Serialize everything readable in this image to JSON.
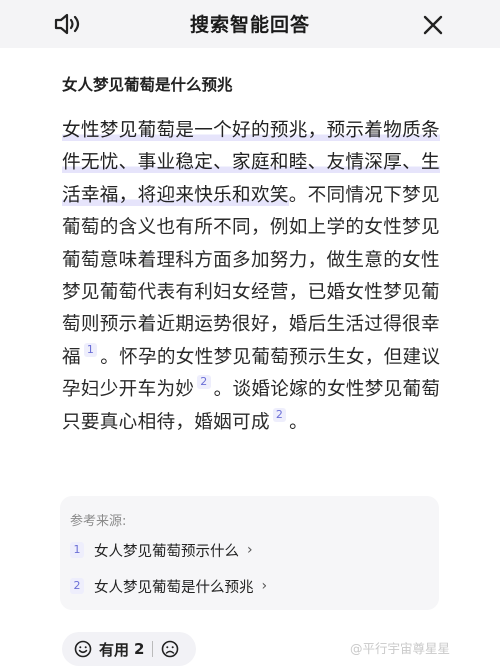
{
  "header": {
    "title": "搜索智能回答",
    "speaker_icon": "speaker-icon",
    "close_icon": "close-icon"
  },
  "question": "女人梦见葡萄是什么预兆",
  "answer": {
    "highlight": "女性梦见葡萄是一个好的预兆，预示着物质条件无忧、事业稳定、家庭和睦、友情深厚、生活幸福，将迎来快乐和欢笑",
    "part1": "。不同情况下梦见葡萄的含义也有所不同，例如上学的女性梦见葡萄意味着理科方面多加努力，做生意的女性梦见葡萄代表有利妇女经营，已婚女性梦见葡萄则预示着近期运势很好，婚后生活过得很幸福",
    "ref1": "1",
    "part2": "。怀孕的女性梦见葡萄预示生女，但建议孕妇少开车为妙",
    "ref2": "2",
    "part3": "。谈婚论嫁的女性梦见葡萄只要真心相待，婚姻可成",
    "ref3": "2",
    "part4": "。"
  },
  "sources": {
    "title": "参考来源:",
    "items": [
      {
        "num": "1",
        "label": "女人梦见葡萄预示什么"
      },
      {
        "num": "2",
        "label": "女人梦见葡萄是什么预兆"
      }
    ]
  },
  "feedback": {
    "like_label": "有用",
    "like_count": "2"
  },
  "watermark": "@平行宇宙尊星星"
}
